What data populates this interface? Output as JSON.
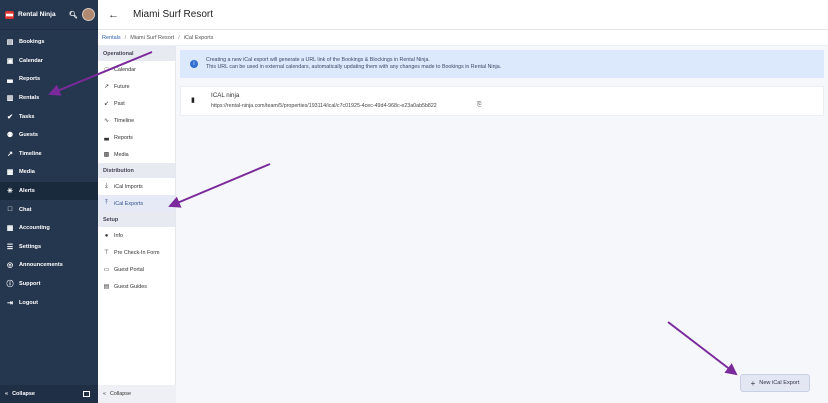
{
  "app": {
    "name": "Rental Ninja"
  },
  "header": {
    "title": "Miami Surf Resort"
  },
  "breadcrumb": {
    "root": "Rentals",
    "rental": "Miami Surf Resort",
    "current": "iCal Exports"
  },
  "sidebar": {
    "items": [
      {
        "label": "Bookings",
        "icon": "bookings-icon"
      },
      {
        "label": "Calendar",
        "icon": "calendar-icon"
      },
      {
        "label": "Reports",
        "icon": "bar-chart-icon"
      },
      {
        "label": "Rentals",
        "icon": "rentals-icon"
      },
      {
        "label": "Tasks",
        "icon": "check-circle-icon"
      },
      {
        "label": "Guests",
        "icon": "guests-icon"
      },
      {
        "label": "Timeline",
        "icon": "timeline-icon"
      },
      {
        "label": "Media",
        "icon": "image-icon"
      },
      {
        "label": "Alerts",
        "icon": "alert-icon"
      },
      {
        "label": "Chat",
        "icon": "chat-icon"
      },
      {
        "label": "Accounting",
        "icon": "accounting-icon"
      },
      {
        "label": "Settings",
        "icon": "settings-icon"
      },
      {
        "label": "Announcements",
        "icon": "announcements-icon"
      },
      {
        "label": "Support",
        "icon": "help-icon"
      },
      {
        "label": "Logout",
        "icon": "logout-icon"
      }
    ],
    "collapse": "Collapse"
  },
  "subnav": {
    "operational_label": "Operational",
    "operational": [
      "Calendar",
      "Future",
      "Past",
      "Timeline",
      "Reports",
      "Media"
    ],
    "distribution_label": "Distribution",
    "distribution": [
      "iCal Imports",
      "iCal Exports"
    ],
    "setup_label": "Setup",
    "setup": [
      "Info",
      "Pre Check-In Form",
      "Guest Portal",
      "Guest Guides"
    ],
    "collapse": "Collapse"
  },
  "info": {
    "line1": "Creating a new iCal export will generate a URL link of the Bookings & Blockings in Rental Ninja.",
    "line2": "This URL can be used in external calendars, automatically updating them with any changes made to Bookings in Rental Ninja."
  },
  "export": {
    "name": "ICAL ninja",
    "url": "https://rental-ninja.com/team/5/properties/193114/ical/c7c01925-4cec-49d4-968c-e23a0ab5b822"
  },
  "new_button": "New iCal Export",
  "colors": {
    "sidebar": "#25374f",
    "accent": "#2f5fb4",
    "arrow": "#7a2a9a",
    "info_bg": "#dce8fb"
  }
}
